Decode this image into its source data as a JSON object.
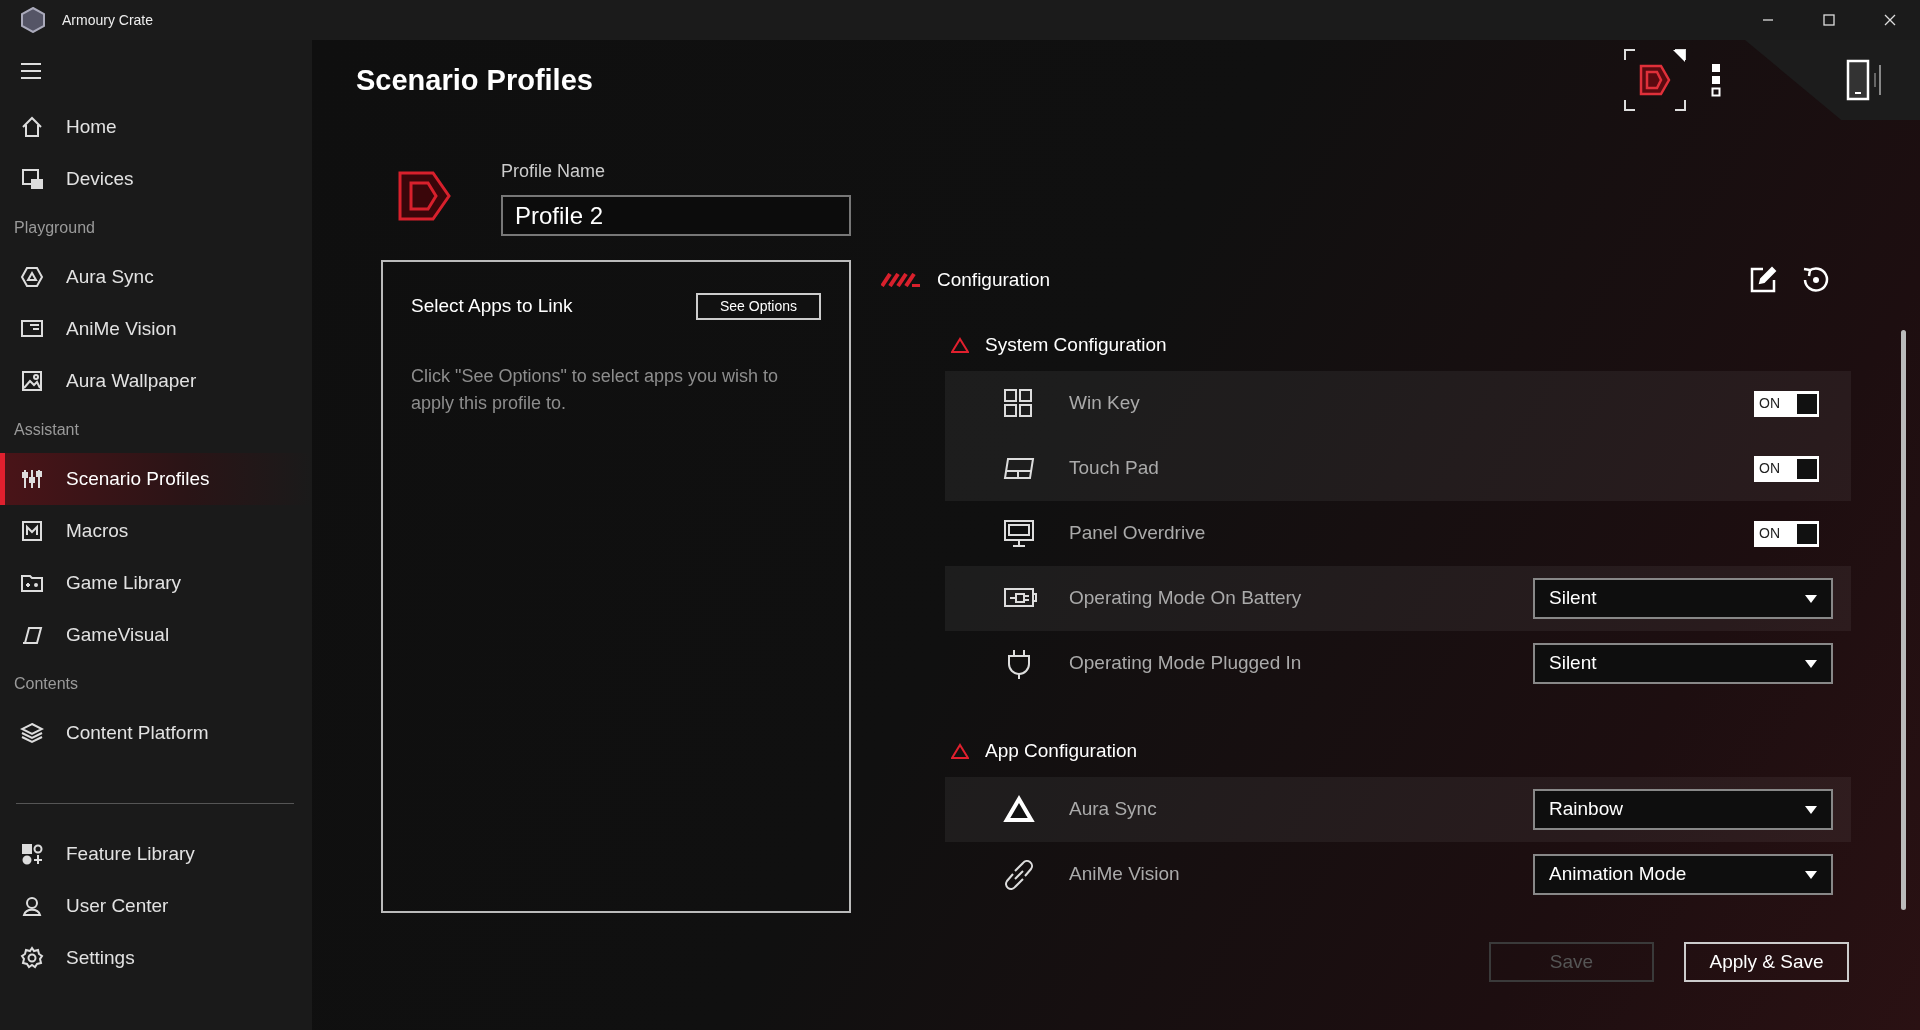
{
  "window": {
    "title": "Armoury Crate"
  },
  "sidebar": {
    "items": [
      {
        "kind": "item",
        "label": "Home",
        "selected": false
      },
      {
        "kind": "item",
        "label": "Devices",
        "selected": false
      },
      {
        "kind": "section",
        "label": "Playground"
      },
      {
        "kind": "item",
        "label": "Aura Sync",
        "selected": false
      },
      {
        "kind": "item",
        "label": "AniMe Vision",
        "selected": false
      },
      {
        "kind": "item",
        "label": "Aura Wallpaper",
        "selected": false
      },
      {
        "kind": "section",
        "label": "Assistant"
      },
      {
        "kind": "item",
        "label": "Scenario Profiles",
        "selected": true
      },
      {
        "kind": "item",
        "label": "Macros",
        "selected": false
      },
      {
        "kind": "item",
        "label": "Game Library",
        "selected": false
      },
      {
        "kind": "item",
        "label": "GameVisual",
        "selected": false
      },
      {
        "kind": "section",
        "label": "Contents"
      },
      {
        "kind": "item",
        "label": "Content Platform",
        "selected": false
      }
    ],
    "bottom_items": [
      {
        "label": "Feature Library"
      },
      {
        "label": "User Center"
      },
      {
        "label": "Settings"
      }
    ]
  },
  "page": {
    "title": "Scenario Profiles"
  },
  "profile": {
    "label": "Profile Name",
    "value": "Profile 2"
  },
  "link_panel": {
    "title": "Select Apps to Link",
    "button": "See Options",
    "hint": "Click \"See Options\" to select apps you wish to apply this profile to."
  },
  "configuration": {
    "title": "Configuration",
    "sections": [
      {
        "title": "System Configuration",
        "rows": [
          {
            "kind": "toggle",
            "label": "Win Key",
            "on": true,
            "toggle_label": "ON",
            "shaded": true
          },
          {
            "kind": "toggle",
            "label": "Touch Pad",
            "on": true,
            "toggle_label": "ON",
            "shaded": true
          },
          {
            "kind": "toggle",
            "label": "Panel Overdrive",
            "on": true,
            "toggle_label": "ON",
            "shaded": false
          },
          {
            "kind": "dropdown",
            "label": "Operating Mode On Battery",
            "value": "Silent",
            "shaded": true
          },
          {
            "kind": "dropdown",
            "label": "Operating Mode Plugged In",
            "value": "Silent",
            "shaded": false
          }
        ]
      },
      {
        "title": "App Configuration",
        "rows": [
          {
            "kind": "dropdown",
            "label": "Aura Sync",
            "value": "Rainbow",
            "shaded": true
          },
          {
            "kind": "dropdown",
            "label": "AniMe Vision",
            "value": "Animation Mode",
            "shaded": false
          }
        ]
      }
    ]
  },
  "buttons": [
    {
      "label": "Save",
      "disabled": true
    },
    {
      "label": "Apply & Save",
      "disabled": false
    }
  ]
}
